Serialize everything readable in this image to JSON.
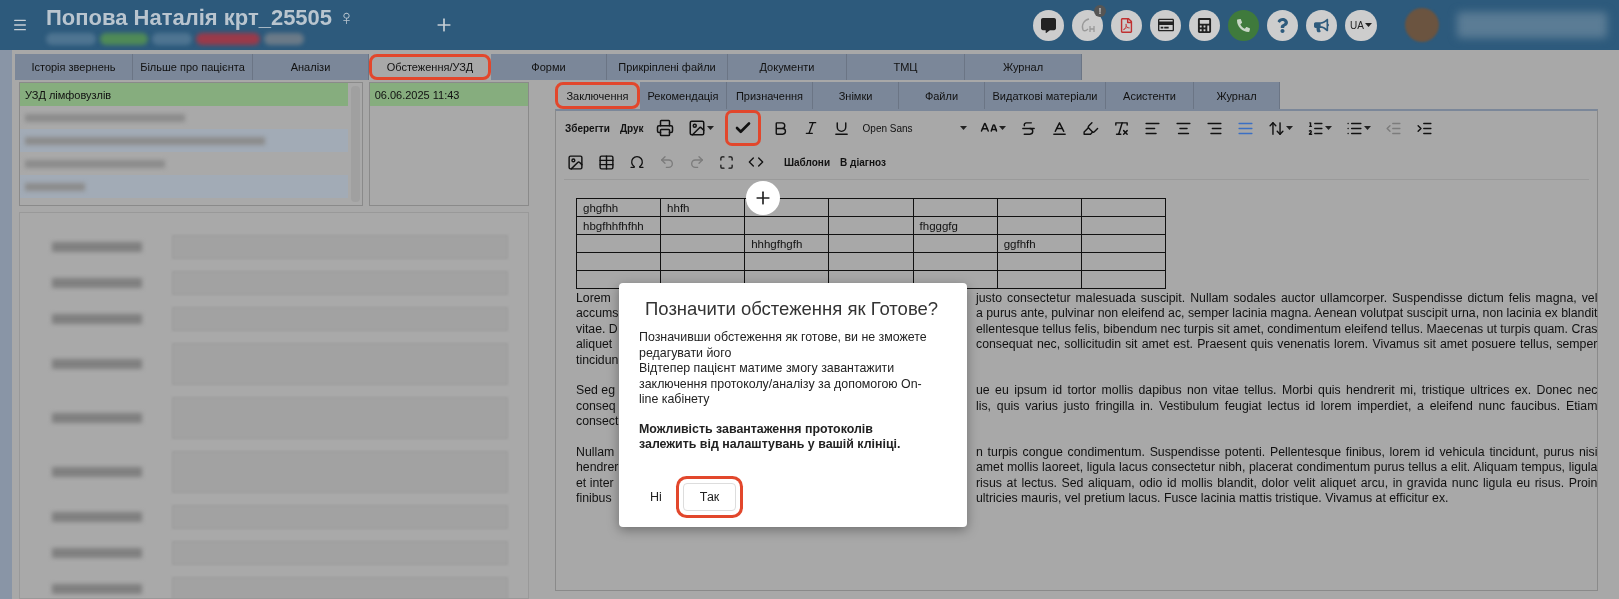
{
  "header": {
    "patient_name": "Попова Наталія крт_25505 ♀",
    "notification_badge": "!",
    "language": "UA"
  },
  "tabs": [
    {
      "label": "Історія звернень",
      "selected": false,
      "highlighted": false
    },
    {
      "label": "Більше про пацієнта",
      "selected": false,
      "highlighted": false
    },
    {
      "label": "Аналізи",
      "selected": false,
      "highlighted": false
    },
    {
      "label": "Обстеження/УЗД",
      "selected": true,
      "highlighted": true
    },
    {
      "label": "Форми",
      "selected": false,
      "highlighted": false
    },
    {
      "label": "Прикріплені файли",
      "selected": false,
      "highlighted": false
    },
    {
      "label": "Документи",
      "selected": false,
      "highlighted": false
    },
    {
      "label": "ТМЦ",
      "selected": false,
      "highlighted": false
    },
    {
      "label": "Журнал",
      "selected": false,
      "highlighted": false
    }
  ],
  "exam_list": {
    "items": [
      {
        "label": "УЗД лімфовузлів",
        "selected": true
      }
    ]
  },
  "date_list": {
    "items": [
      {
        "label": "06.06.2025 11:43",
        "selected": true
      }
    ]
  },
  "subtabs": [
    {
      "label": "Заключення",
      "selected": true,
      "highlighted": true
    },
    {
      "label": "Рекомендація",
      "selected": false,
      "highlighted": false
    },
    {
      "label": "Призначення",
      "selected": false,
      "highlighted": false
    },
    {
      "label": "Знімки",
      "selected": false,
      "highlighted": false
    },
    {
      "label": "Файли",
      "selected": false,
      "highlighted": false
    },
    {
      "label": "Видаткові матеріали",
      "selected": false,
      "highlighted": false
    },
    {
      "label": "Асистенти",
      "selected": false,
      "highlighted": false
    },
    {
      "label": "Журнал",
      "selected": false,
      "highlighted": false
    }
  ],
  "toolbar": {
    "save": "Зберегти",
    "print": "Друк",
    "font": "Open Sans",
    "templates": "Шаблони",
    "to_diagnosis": "В діагноз",
    "mark_done_highlighted": true,
    "justify_active": true,
    "outdent_disabled": true,
    "undo_disabled": true,
    "redo_disabled": true
  },
  "table": {
    "rows": [
      [
        "ghgfhh",
        "hhfh",
        null,
        null,
        null,
        null,
        null
      ],
      [
        "hbgfhhfhfhh",
        null,
        null,
        null,
        "fhgggfg",
        null,
        null
      ],
      [
        null,
        null,
        "hhhgfhgfh",
        null,
        null,
        "ggfhfh",
        null
      ],
      [
        null,
        null,
        null,
        null,
        null,
        null,
        null
      ],
      [
        null,
        null,
        null,
        null,
        null,
        null,
        null
      ]
    ]
  },
  "text": {
    "paragraphs": [
      {
        "lines": [
          {
            "left": "Lorem",
            "right": "justo consectetur malesuada suscipit. Nullam sodales auctor ullamcorper. Suspendisse dictum felis magna, vel"
          },
          {
            "left": "accums",
            "right": "a purus ante, pulvinar non eleifend ac, semper lacinia magna. Aenean volutpat suscipit urna, non lacinia ex blandit"
          },
          {
            "left": "vitae. D",
            "right": "ellentesque tellus felis, bibendum nec turpis sit amet, condimentum eleifend tellus. Maecenas ut turpis quam. Cras"
          },
          {
            "left": "aliquet",
            "right": "consequat nec, sollicitudin sit amet est. Praesent quis venenatis lorem. Vivamus sit amet posuere tellus, semper"
          },
          {
            "left": "tincidun"
          }
        ]
      },
      {
        "lines": [
          {
            "left": "Sed eg",
            "right": "ue eu ipsum id tortor mollis dapibus non vitae tellus. Morbi quis hendrerit mi, tristique ultrices ex. Donec nec"
          },
          {
            "left": "conseq",
            "right": "lis, quis varius justo fringilla in. Vestibulum feugiat lectus id lorem imperdiet, a eleifend nunc faucibus. Etiam"
          },
          {
            "left": "consect"
          }
        ]
      },
      {
        "lines": [
          {
            "left": "Nullam",
            "right": "n turpis congue condimentum. Suspendisse potenti. Pellentesque finibus, lorem id vehicula tincidunt, purus nisi"
          },
          {
            "left": "hendrer",
            "right": "amet mollis laoreet, ligula lacus consectetur nibh, placerat condimentum purus tellus a elit. Aliquam tempus, ligula"
          },
          {
            "left": "et inter",
            "right": "risus at lectus. Sed aliquam, odio id mollis blandit, dolor velit aliquet arcu, in gravida nunc ligula eu risus. Proin"
          },
          {
            "left": "finibus",
            "right": "ultricies mauris, vel pretium lacus. Fusce lacinia mattis tristique. Vivamus at efficitur ex."
          }
        ]
      }
    ]
  },
  "dialog": {
    "title": "Позначити обстеження як Готове?",
    "paragraphs": [
      {
        "bold": false,
        "lines": [
          "Позначивши обстеження як готове, ви не зможете редагувати його",
          "Відтепер пацієнт матиме змогу завантажити заключення протоколу/аналізу за допомогою On-line кабінету"
        ]
      },
      {
        "bold": true,
        "lines": [
          "Можливість завантаження протоколів залежить від налаштувань у вашій клініці."
        ]
      }
    ],
    "buttons": [
      {
        "label": "Ні",
        "highlighted": false
      },
      {
        "label": "Так",
        "highlighted": true
      }
    ]
  }
}
